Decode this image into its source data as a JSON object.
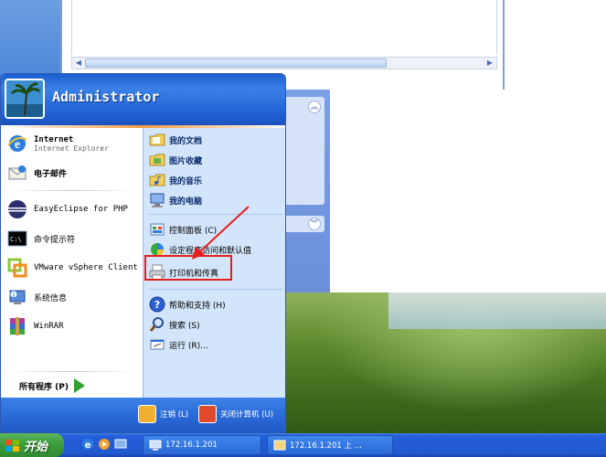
{
  "user": {
    "name": "Administrator"
  },
  "pinned": [
    {
      "title": "Internet",
      "subtitle": "Internet Explorer",
      "icon": "internet-explorer-icon"
    },
    {
      "title": "电子邮件",
      "icon": "email-icon"
    }
  ],
  "recent": [
    {
      "label": "EasyEclipse for PHP",
      "icon": "eclipse-icon"
    },
    {
      "label": "命令提示符",
      "icon": "command-prompt-icon"
    },
    {
      "label": "VMware vSphere Client",
      "icon": "vmware-icon"
    },
    {
      "label": "系统信息",
      "icon": "system-info-icon"
    },
    {
      "label": "WinRAR",
      "icon": "winrar-icon"
    }
  ],
  "all_programs": "所有程序 (P)",
  "places": [
    {
      "label": "我的文档",
      "icon": "my-documents-icon"
    },
    {
      "label": "图片收藏",
      "icon": "my-pictures-icon"
    },
    {
      "label": "我的音乐",
      "icon": "my-music-icon"
    },
    {
      "label": "我的电脑",
      "icon": "my-computer-icon"
    }
  ],
  "settings": [
    {
      "label": "控制面板 (C)",
      "icon": "control-panel-icon"
    },
    {
      "label": "设定程序访问和默认值",
      "icon": "program-defaults-icon"
    },
    {
      "label": "打印机和传真",
      "icon": "printer-icon"
    }
  ],
  "help": [
    {
      "label": "帮助和支持 (H)",
      "icon": "help-icon"
    },
    {
      "label": "搜索 (S)",
      "icon": "search-icon"
    },
    {
      "label": "运行 (R)...",
      "icon": "run-icon"
    }
  ],
  "footer": {
    "logoff": "注销 (L)",
    "shutdown": "关闭计算机 (U)"
  },
  "taskbar": {
    "start": "开始",
    "tasks": [
      "172.16.1.201",
      "172.16.1.201 上 ..."
    ]
  },
  "colors": {
    "highlight": "#e61e1e",
    "start_green": "#3a9d3a",
    "xp_blue": "#245edb"
  }
}
